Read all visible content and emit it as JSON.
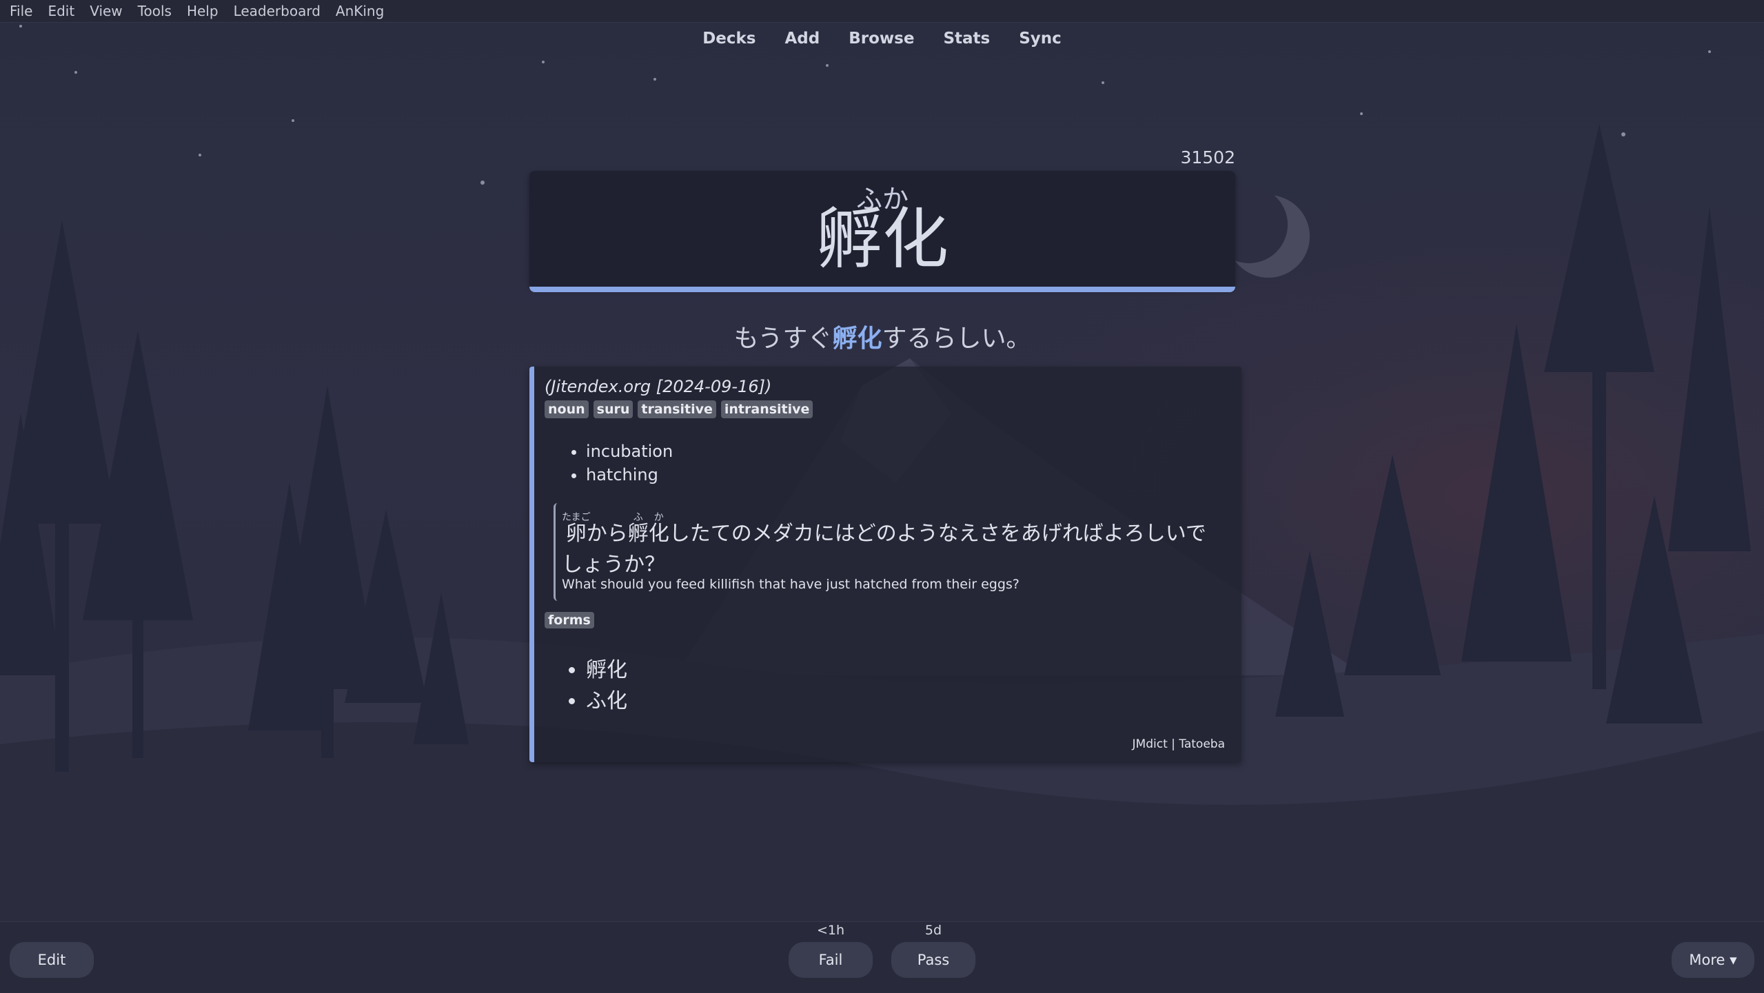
{
  "menu": [
    "File",
    "Edit",
    "View",
    "Tools",
    "Help",
    "Leaderboard",
    "AnKing"
  ],
  "toolbar": [
    "Decks",
    "Add",
    "Browse",
    "Stats",
    "Sync"
  ],
  "card": {
    "number": "31502",
    "reading": "ふか",
    "word": "孵化",
    "sentence_before": "もうすぐ",
    "sentence_highlight": "孵化",
    "sentence_after": "するらしい。"
  },
  "definition": {
    "source": "(Jitendex.org [2024-09-16])",
    "tags": [
      "noun",
      "suru",
      "transitive",
      "intransitive"
    ],
    "glosses": [
      "incubation",
      "hatching"
    ],
    "example": {
      "kanji1": "卵",
      "kanji1_reading": "たまご",
      "text1": "から",
      "kanji2a": "孵",
      "kanji2a_reading": "ふ",
      "kanji2b": "化",
      "kanji2b_reading": "か",
      "text2": "したてのメダカにはどのようなえさをあげればよろしいでしょうか？",
      "english": "What should you feed killifish that have just hatched from their eggs?"
    },
    "forms_tag": "forms",
    "forms": [
      "孵化",
      "ふ化"
    ],
    "footer": "JMdict | Tatoeba"
  },
  "bottom": {
    "edit_label": "Edit",
    "fail_label": "Fail",
    "fail_due": "<1h",
    "pass_label": "Pass",
    "pass_due": "5d",
    "more_label": "More ▾"
  }
}
